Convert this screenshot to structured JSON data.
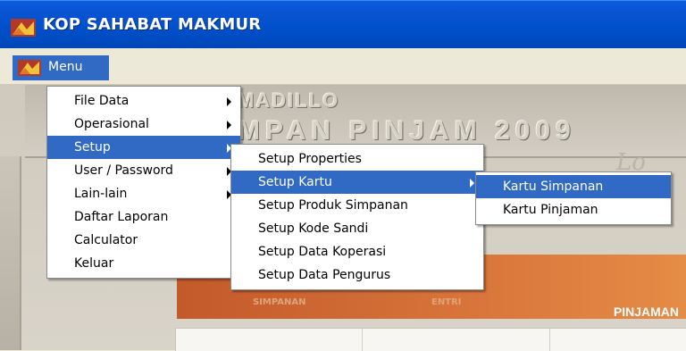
{
  "window": {
    "title": "KOP SAHABAT MAKMUR"
  },
  "menubar": {
    "menu_label": "Menu"
  },
  "menu1": {
    "items": [
      {
        "label": "File Data",
        "has_submenu": true
      },
      {
        "label": "Operasional",
        "has_submenu": true
      },
      {
        "label": "Setup",
        "has_submenu": true,
        "active": true
      },
      {
        "label": "User / Password",
        "has_submenu": true
      },
      {
        "label": "Lain-lain",
        "has_submenu": true
      },
      {
        "label": "Daftar Laporan",
        "has_submenu": false
      },
      {
        "label": "Calculator",
        "has_submenu": false
      },
      {
        "label": "Keluar",
        "has_submenu": false
      }
    ]
  },
  "menu2": {
    "items": [
      {
        "label": "Setup Properties"
      },
      {
        "label": "Setup Kartu",
        "has_submenu": true,
        "active": true
      },
      {
        "label": "Setup Produk Simpanan"
      },
      {
        "label": "Setup Kode Sandi"
      },
      {
        "label": "Setup Data Koperasi"
      },
      {
        "label": "Setup Data Pengurus"
      }
    ]
  },
  "menu3": {
    "items": [
      {
        "label": "Kartu Simpanan",
        "active": true
      },
      {
        "label": "Kartu Pinjaman"
      }
    ]
  },
  "background": {
    "line1": "MADILLO",
    "line2": "MPAN PINJAM 2009",
    "script": "Lo",
    "panel_label": "PINJAMAN",
    "faint_label_a": "SIMPANAN",
    "faint_label_b": "ENTRI"
  },
  "colors": {
    "titlebar": "#0050ca",
    "highlight": "#316ac5",
    "menu_bg": "#ffffff",
    "orange_panel": "#d8733a"
  }
}
